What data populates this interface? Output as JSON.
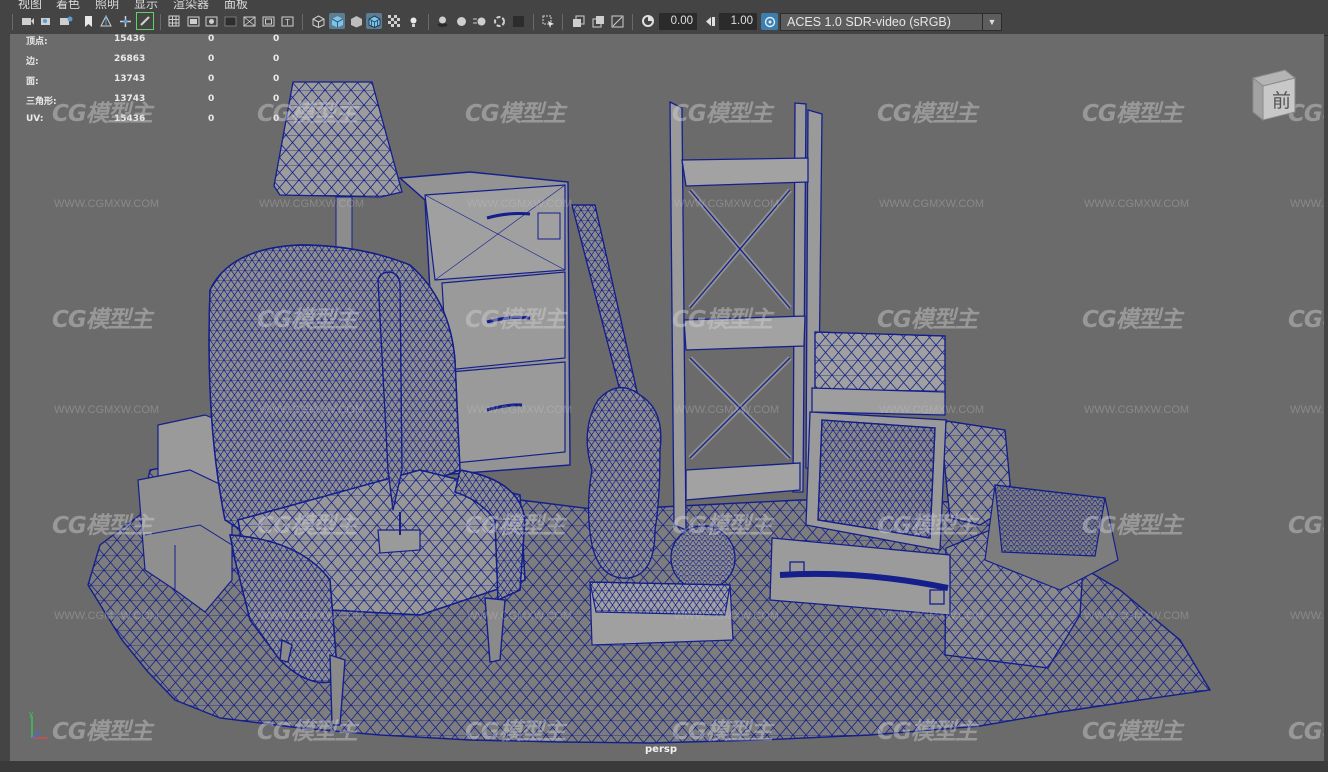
{
  "menu": [
    "视图",
    "着色",
    "照明",
    "显示",
    "渲染器",
    "面板"
  ],
  "toolbar": {
    "exposure": "0.00",
    "gamma": "1.00",
    "color_space": "ACES 1.0 SDR-video (sRGB)",
    "icons": [
      "camera-select-icon",
      "camera-attributes-icon",
      "bookmark-icon",
      "image-plane-icon",
      "grease-pencil-icon",
      "grid-icon",
      "film-gate-icon",
      "resolution-gate-icon",
      "gate-mask-icon",
      "field-chart-icon",
      "safe-action-icon",
      "safe-title-icon",
      "wireframe-icon",
      "smooth-shade-icon",
      "wireframe-on-shaded-icon",
      "textured-icon",
      "use-all-lights-icon",
      "shadows-icon",
      "screen-space-ao-icon",
      "motion-blur-icon",
      "anti-aliasing-icon",
      "depth-of-field-icon",
      "isolate-select-icon",
      "xray-icon",
      "xray-joints-icon",
      "xray-active-icon",
      "exposure-icon",
      "gamma-icon",
      "color-management-icon"
    ]
  },
  "hud": {
    "rows": [
      {
        "label": "顶点:",
        "v1": "15436",
        "v2": "0",
        "v3": "0"
      },
      {
        "label": "边:",
        "v1": "26863",
        "v2": "0",
        "v3": "0"
      },
      {
        "label": "面:",
        "v1": "13743",
        "v2": "0",
        "v3": "0"
      },
      {
        "label": "三角形:",
        "v1": "13743",
        "v2": "0",
        "v3": "0"
      },
      {
        "label": "UV:",
        "v1": "15436",
        "v2": "0",
        "v3": "0"
      }
    ]
  },
  "viewcube": {
    "label": "前"
  },
  "camera": {
    "label": "persp"
  },
  "watermark": {
    "logo": "CG模型主",
    "url": "WWW.CGMXW.COM"
  },
  "colors": {
    "viewport_bg": "#6b6b6b",
    "wire": "#141f8c",
    "mesh_fill": "#828282",
    "ui_bg": "#444444"
  }
}
